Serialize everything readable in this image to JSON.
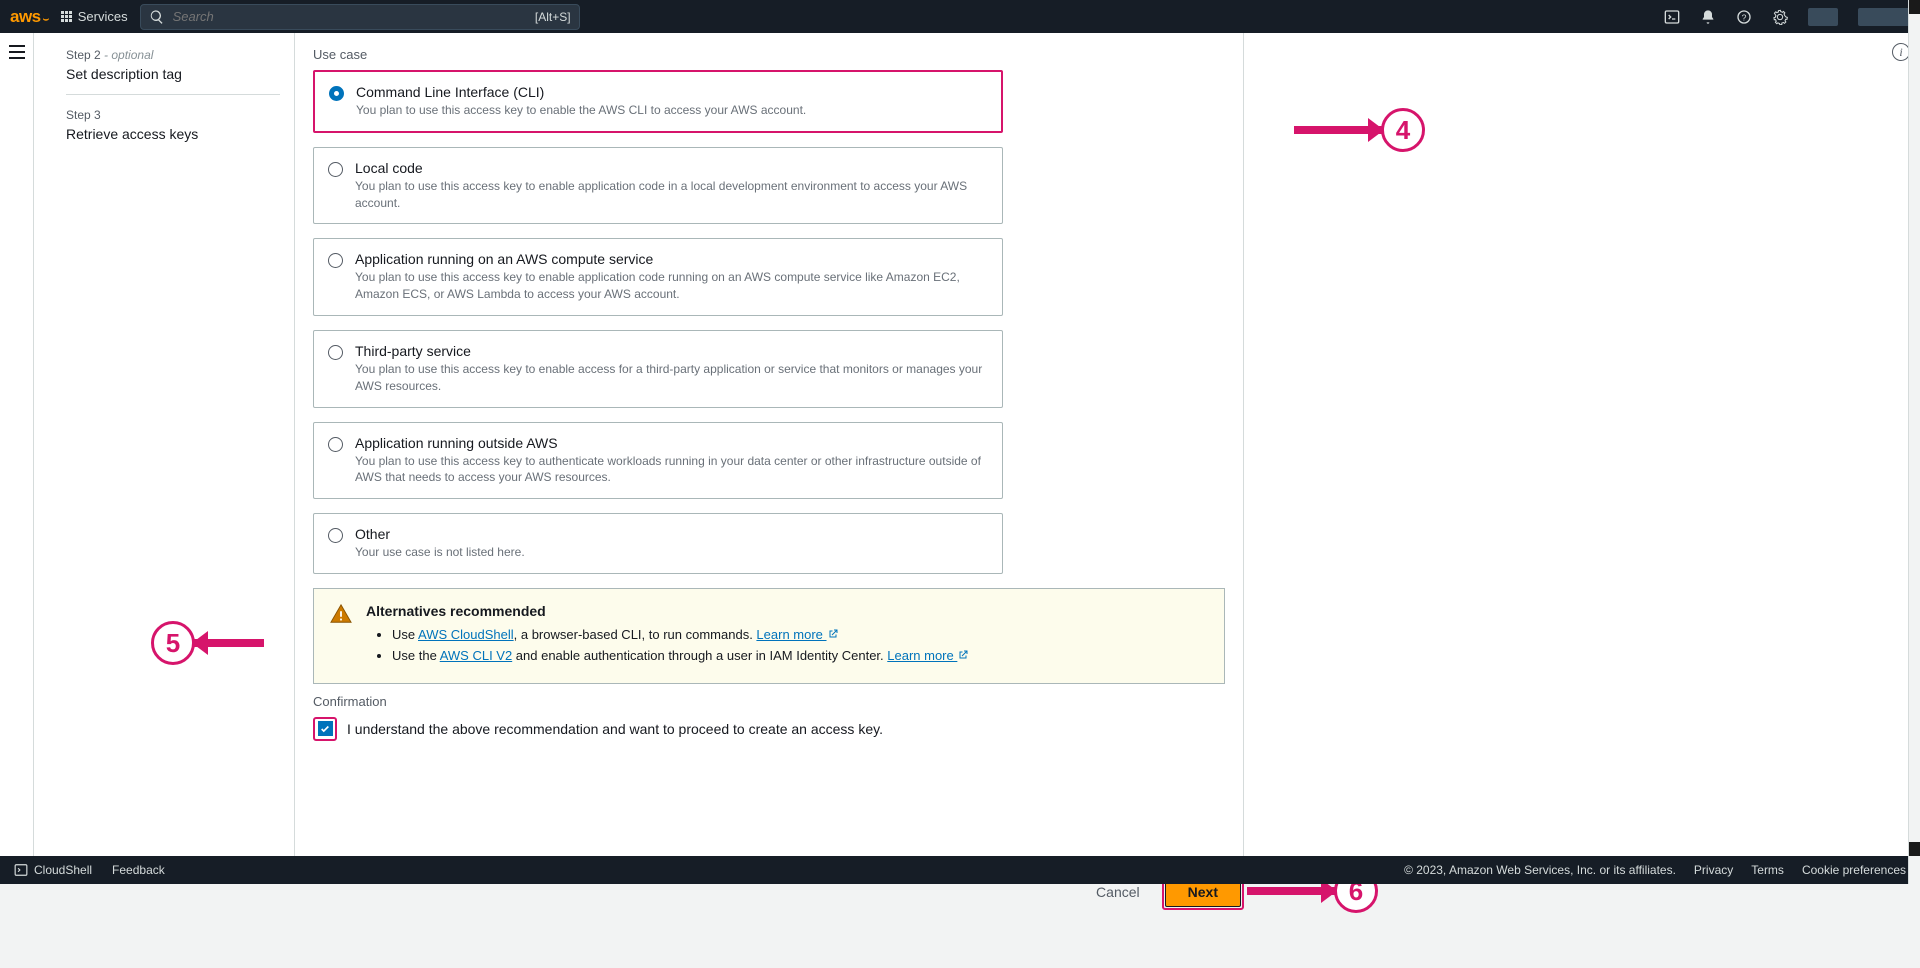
{
  "nav": {
    "services": "Services",
    "search_placeholder": "Search",
    "shortcut": "[Alt+S]"
  },
  "sidebar": {
    "step2": {
      "head": "Step 2",
      "optional": " - optional",
      "title": "Set description tag"
    },
    "step3": {
      "head": "Step 3",
      "title": "Retrieve access keys"
    }
  },
  "section": {
    "use_case": "Use case",
    "options": [
      {
        "title": "Command Line Interface (CLI)",
        "desc": "You plan to use this access key to enable the AWS CLI to access your AWS account.",
        "selected": true
      },
      {
        "title": "Local code",
        "desc": "You plan to use this access key to enable application code in a local development environment to access your AWS account.",
        "selected": false
      },
      {
        "title": "Application running on an AWS compute service",
        "desc": "You plan to use this access key to enable application code running on an AWS compute service like Amazon EC2, Amazon ECS, or AWS Lambda to access your AWS account.",
        "selected": false
      },
      {
        "title": "Third-party service",
        "desc": "You plan to use this access key to enable access for a third-party application or service that monitors or manages your AWS resources.",
        "selected": false
      },
      {
        "title": "Application running outside AWS",
        "desc": "You plan to use this access key to authenticate workloads running in your data center or other infrastructure outside of AWS that needs to access your AWS resources.",
        "selected": false
      },
      {
        "title": "Other",
        "desc": "Your use case is not listed here.",
        "selected": false
      }
    ]
  },
  "alert": {
    "title": "Alternatives recommended",
    "bullet1_pre": "Use ",
    "bullet1_link": "AWS CloudShell",
    "bullet1_post": ", a browser-based CLI, to run commands. ",
    "bullet1_learn": "Learn more ",
    "bullet2_pre": "Use the ",
    "bullet2_link": "AWS CLI V2",
    "bullet2_post": " and enable authentication through a user in IAM Identity Center. ",
    "bullet2_learn": "Learn more "
  },
  "confirmation": {
    "label": "Confirmation",
    "text": "I understand the above recommendation and want to proceed to create an access key."
  },
  "actions": {
    "cancel": "Cancel",
    "next": "Next"
  },
  "footer": {
    "cloudshell": "CloudShell",
    "feedback": "Feedback",
    "copyright": "© 2023, Amazon Web Services, Inc. or its affiliates.",
    "privacy": "Privacy",
    "terms": "Terms",
    "cookie": "Cookie preferences"
  },
  "annotations": {
    "n4": "4",
    "n5": "5",
    "n6": "6"
  }
}
